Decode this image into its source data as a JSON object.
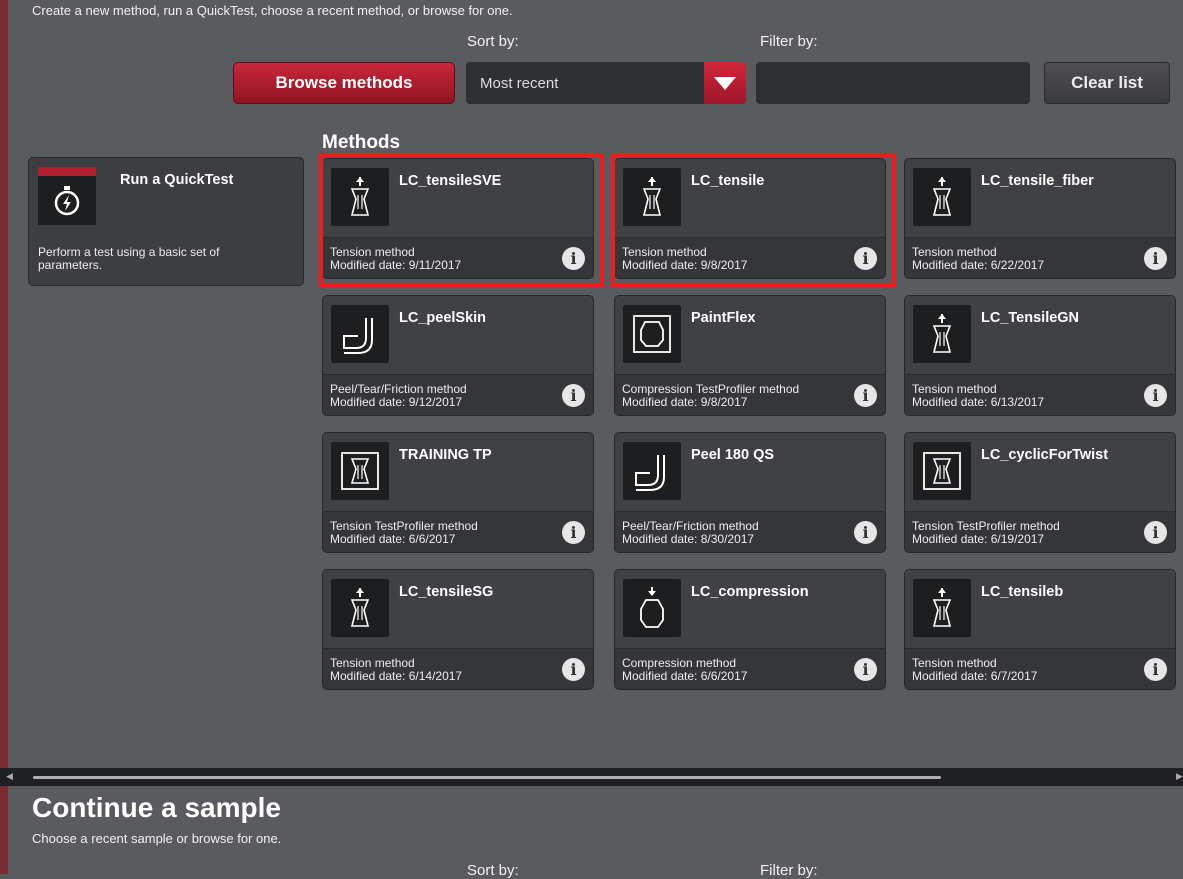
{
  "header": {
    "intro": "Create a new method, run a QuickTest, choose a recent method, or browse for one.",
    "sort_label": "Sort by:",
    "filter_label": "Filter by:",
    "browse_label": "Browse methods",
    "sort_value": "Most recent",
    "filter_value": "",
    "clear_label": "Clear list"
  },
  "methods_title": "Methods",
  "quicktest": {
    "title": "Run a QuickTest",
    "description": "Perform a test using a basic set of parameters."
  },
  "methods": [
    {
      "name": "LC_tensileSVE",
      "type": "Tension method",
      "date": "Modified date: 9/11/2017",
      "icon": "tension-icon",
      "highlighted": true
    },
    {
      "name": "LC_tensile",
      "type": "Tension method",
      "date": "Modified date: 9/8/2017",
      "icon": "tension-icon",
      "highlighted": true
    },
    {
      "name": "LC_tensile_fiber",
      "type": "Tension method",
      "date": "Modified date: 6/22/2017",
      "icon": "tension-icon",
      "highlighted": false
    },
    {
      "name": "LC_peelSkin",
      "type": "Peel/Tear/Friction method",
      "date": "Modified date: 9/12/2017",
      "icon": "peel-icon",
      "highlighted": false
    },
    {
      "name": "PaintFlex",
      "type": "Compression TestProfiler method",
      "date": "Modified date: 9/8/2017",
      "icon": "compression-profiler-icon",
      "highlighted": false
    },
    {
      "name": "LC_TensileGN",
      "type": "Tension method",
      "date": "Modified date: 6/13/2017",
      "icon": "tension-icon",
      "highlighted": false
    },
    {
      "name": "TRAINING TP",
      "type": "Tension TestProfiler method",
      "date": "Modified date: 6/6/2017",
      "icon": "tension-profiler-icon",
      "highlighted": false
    },
    {
      "name": "Peel 180 QS",
      "type": "Peel/Tear/Friction method",
      "date": "Modified date: 8/30/2017",
      "icon": "peel-icon",
      "highlighted": false
    },
    {
      "name": "LC_cyclicForTwist",
      "type": "Tension TestProfiler method",
      "date": "Modified date: 6/19/2017",
      "icon": "tension-profiler-icon",
      "highlighted": false
    },
    {
      "name": "LC_tensileSG",
      "type": "Tension method",
      "date": "Modified date: 6/14/2017",
      "icon": "tension-icon",
      "highlighted": false
    },
    {
      "name": "LC_compression",
      "type": "Compression method",
      "date": "Modified date: 6/6/2017",
      "icon": "compression-icon",
      "highlighted": false
    },
    {
      "name": "LC_tensileb",
      "type": "Tension method",
      "date": "Modified date: 6/7/2017",
      "icon": "tension-icon",
      "highlighted": false
    }
  ],
  "info_glyph": "i",
  "continue": {
    "title": "Continue a sample",
    "subtitle": "Choose a recent sample or browse for one.",
    "sort_label": "Sort by:",
    "filter_label": "Filter by:"
  },
  "colors": {
    "background": "#5a5b5f",
    "accent": "#c9283a",
    "highlight": "#ee1c1c"
  }
}
